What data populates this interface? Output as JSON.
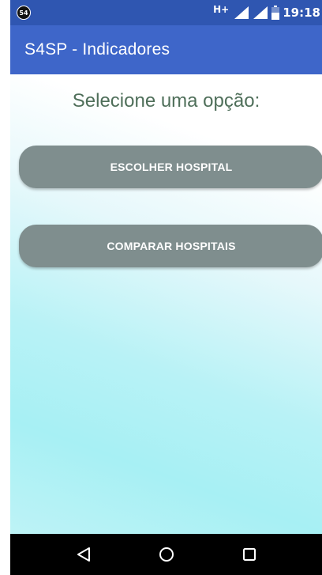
{
  "status_bar": {
    "notification_count": "54",
    "network_type": "H+",
    "time": "19:18",
    "icons": [
      "signal-icon",
      "signal-icon",
      "battery-icon"
    ]
  },
  "app_bar": {
    "title": "S4SP - Indicadores"
  },
  "main": {
    "prompt": "Selecione uma opção:",
    "buttons": [
      {
        "label": "ESCOLHER HOSPITAL"
      },
      {
        "label": "COMPARAR HOSPITAIS"
      }
    ]
  },
  "nav_bar": {
    "icons": [
      "back-icon",
      "home-icon",
      "recents-icon"
    ]
  },
  "colors": {
    "status_bar": "#2f56b1",
    "app_bar": "#3e66c9",
    "button": "#7f8e8e",
    "prompt_text": "#4f6f5a",
    "gradient_cyan": "#a7f0f4"
  }
}
